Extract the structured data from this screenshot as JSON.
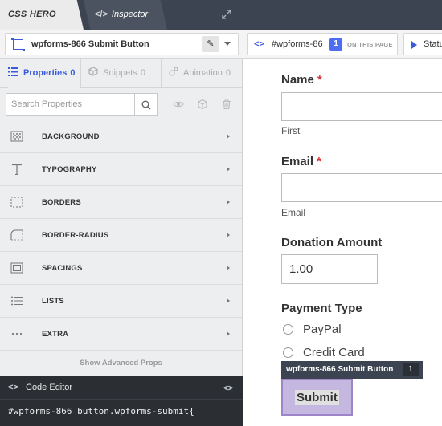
{
  "topbar": {
    "logo": "CSS HERO",
    "inspector_code": "</>",
    "inspector_label": "Inspector"
  },
  "selector": {
    "title": "wpforms-866 Submit Button",
    "path_code": "<>",
    "path_text": "#wpforms-86",
    "path_count": "1",
    "path_note": "ON THIS PAGE",
    "status_label": "Statu"
  },
  "panel": {
    "tabs": [
      {
        "label": "Properties",
        "count": "0"
      },
      {
        "label": "Snippets",
        "count": "0"
      },
      {
        "label": "Animation",
        "count": "0"
      }
    ],
    "search_placeholder": "Search Properties",
    "properties": [
      {
        "label": "BACKGROUND",
        "icon": "background-icon"
      },
      {
        "label": "TYPOGRAPHY",
        "icon": "typography-icon"
      },
      {
        "label": "BORDERS",
        "icon": "borders-icon"
      },
      {
        "label": "BORDER-RADIUS",
        "icon": "border-radius-icon"
      },
      {
        "label": "SPACINGS",
        "icon": "spacings-icon"
      },
      {
        "label": "LISTS",
        "icon": "lists-icon"
      },
      {
        "label": "EXTRA",
        "icon": "extra-icon"
      }
    ],
    "advanced_label": "Show Advanced Props"
  },
  "code_editor": {
    "code_icon": "<>",
    "title": "Code Editor",
    "line": "#wpforms-866 button.wpforms-submit{"
  },
  "form": {
    "name_label": "Name",
    "required_mark": "*",
    "first_sublabel": "First",
    "email_label": "Email",
    "email_sublabel": "Email",
    "donation_label": "Donation Amount",
    "donation_value": "1.00",
    "payment_label": "Payment Type",
    "payment_options": [
      "PayPal",
      "Credit Card"
    ],
    "tooltip_label": "wpforms-866 Submit Button",
    "tooltip_count": "1",
    "submit_label": "Submit"
  },
  "colors": {
    "accent": "#3b5bdb",
    "topbar": "#3b4450",
    "required": "#e03131",
    "highlight": "#c5b8e0"
  }
}
